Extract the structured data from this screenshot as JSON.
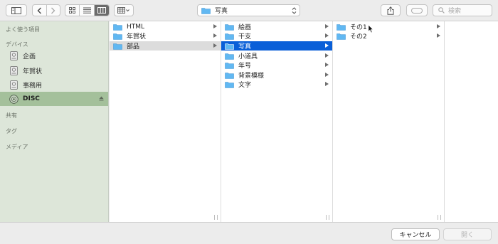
{
  "toolbar": {
    "path_popup_label": "写真",
    "search_placeholder": "検索"
  },
  "sidebar": {
    "favorites_header": "よく使う項目",
    "devices_header": "デバイス",
    "devices": [
      {
        "label": "企画",
        "icon": "disk-icon"
      },
      {
        "label": "年賀状",
        "icon": "disk-icon"
      },
      {
        "label": "事務用",
        "icon": "disk-icon"
      },
      {
        "label": "DISC",
        "icon": "optical-disc-icon",
        "selected": true,
        "ejectable": true
      }
    ],
    "shared_header": "共有",
    "tags_header": "タグ",
    "media_header": "メディア"
  },
  "columns": [
    {
      "items": [
        {
          "label": "HTML",
          "has_children": true
        },
        {
          "label": "年賀状",
          "has_children": true
        },
        {
          "label": "部品",
          "has_children": true,
          "state": "path"
        }
      ]
    },
    {
      "items": [
        {
          "label": "絵画",
          "has_children": true
        },
        {
          "label": "干支",
          "has_children": true
        },
        {
          "label": "写真",
          "has_children": true,
          "state": "selected"
        },
        {
          "label": "小道具",
          "has_children": true
        },
        {
          "label": "年号",
          "has_children": true
        },
        {
          "label": "背景模様",
          "has_children": true
        },
        {
          "label": "文字",
          "has_children": true
        }
      ]
    },
    {
      "items": [
        {
          "label": "その1",
          "has_children": true
        },
        {
          "label": "その2",
          "has_children": true
        }
      ]
    }
  ],
  "footer": {
    "cancel_label": "キャンセル",
    "open_label": "開く"
  },
  "colors": {
    "selection_blue": "#0a5fd8",
    "sidebar_bg": "#dde6d9",
    "sidebar_selected": "#a4c09b",
    "folder_blue": "#61b8f2"
  }
}
